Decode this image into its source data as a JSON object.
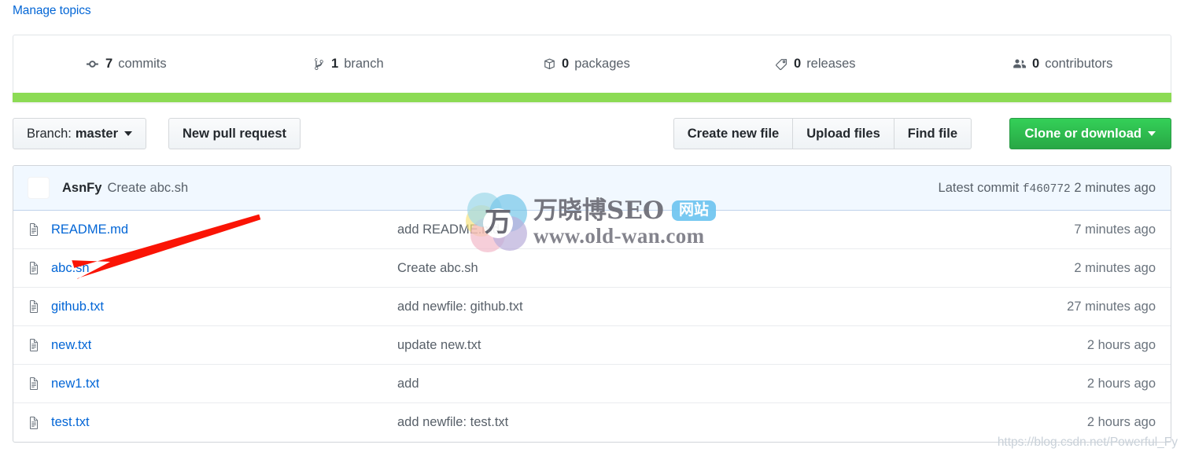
{
  "topics": {
    "manage_link": "Manage topics"
  },
  "stats": [
    {
      "icon": "commits-icon",
      "count": "7",
      "label": "commits"
    },
    {
      "icon": "branch-icon",
      "count": "1",
      "label": "branch"
    },
    {
      "icon": "package-icon",
      "count": "0",
      "label": "packages"
    },
    {
      "icon": "tag-icon",
      "count": "0",
      "label": "releases"
    },
    {
      "icon": "contributors-icon",
      "count": "0",
      "label": "contributors"
    }
  ],
  "language_bar": [
    {
      "color": "#8cdb54",
      "width_pct": 100
    }
  ],
  "toolbar": {
    "branch_prefix": "Branch:",
    "branch_name": "master",
    "new_pull_request": "New pull request",
    "create_new_file": "Create new file",
    "upload_files": "Upload files",
    "find_file": "Find file",
    "clone_or_download": "Clone or download"
  },
  "latest_commit": {
    "author": "AsnFy",
    "message": "Create abc.sh",
    "prefix": "Latest commit",
    "sha": "f460772",
    "time": "2 minutes ago"
  },
  "files": [
    {
      "icon": "file-icon",
      "name": "README.md",
      "message": "add README.md",
      "time": "7 minutes ago"
    },
    {
      "icon": "file-icon",
      "name": "abc.sh",
      "message": "Create abc.sh",
      "time": "2 minutes ago"
    },
    {
      "icon": "file-icon",
      "name": "github.txt",
      "message": "add newfile: github.txt",
      "time": "27 minutes ago"
    },
    {
      "icon": "file-icon",
      "name": "new.txt",
      "message": "update new.txt",
      "time": "2 hours ago"
    },
    {
      "icon": "file-icon",
      "name": "new1.txt",
      "message": "add",
      "time": "2 hours ago"
    },
    {
      "icon": "file-icon",
      "name": "test.txt",
      "message": "add newfile: test.txt",
      "time": "2 hours ago"
    }
  ],
  "annotation": {
    "arrow_color": "#fa1405",
    "arrow_from": "330,275",
    "arrow_to": "140,333"
  },
  "watermark": {
    "logo_glyph": "万",
    "brand_cn": "万晓博SEO",
    "badge": "网站",
    "url": "www.old-wan.com",
    "csdn": "https://blog.csdn.net/Powerful_Fy"
  },
  "colors": {
    "link": "#0366d6",
    "muted": "#586069",
    "clone_green": "#28a745",
    "lang_green": "#8cdb54",
    "commit_header_bg": "#f1f8ff"
  }
}
